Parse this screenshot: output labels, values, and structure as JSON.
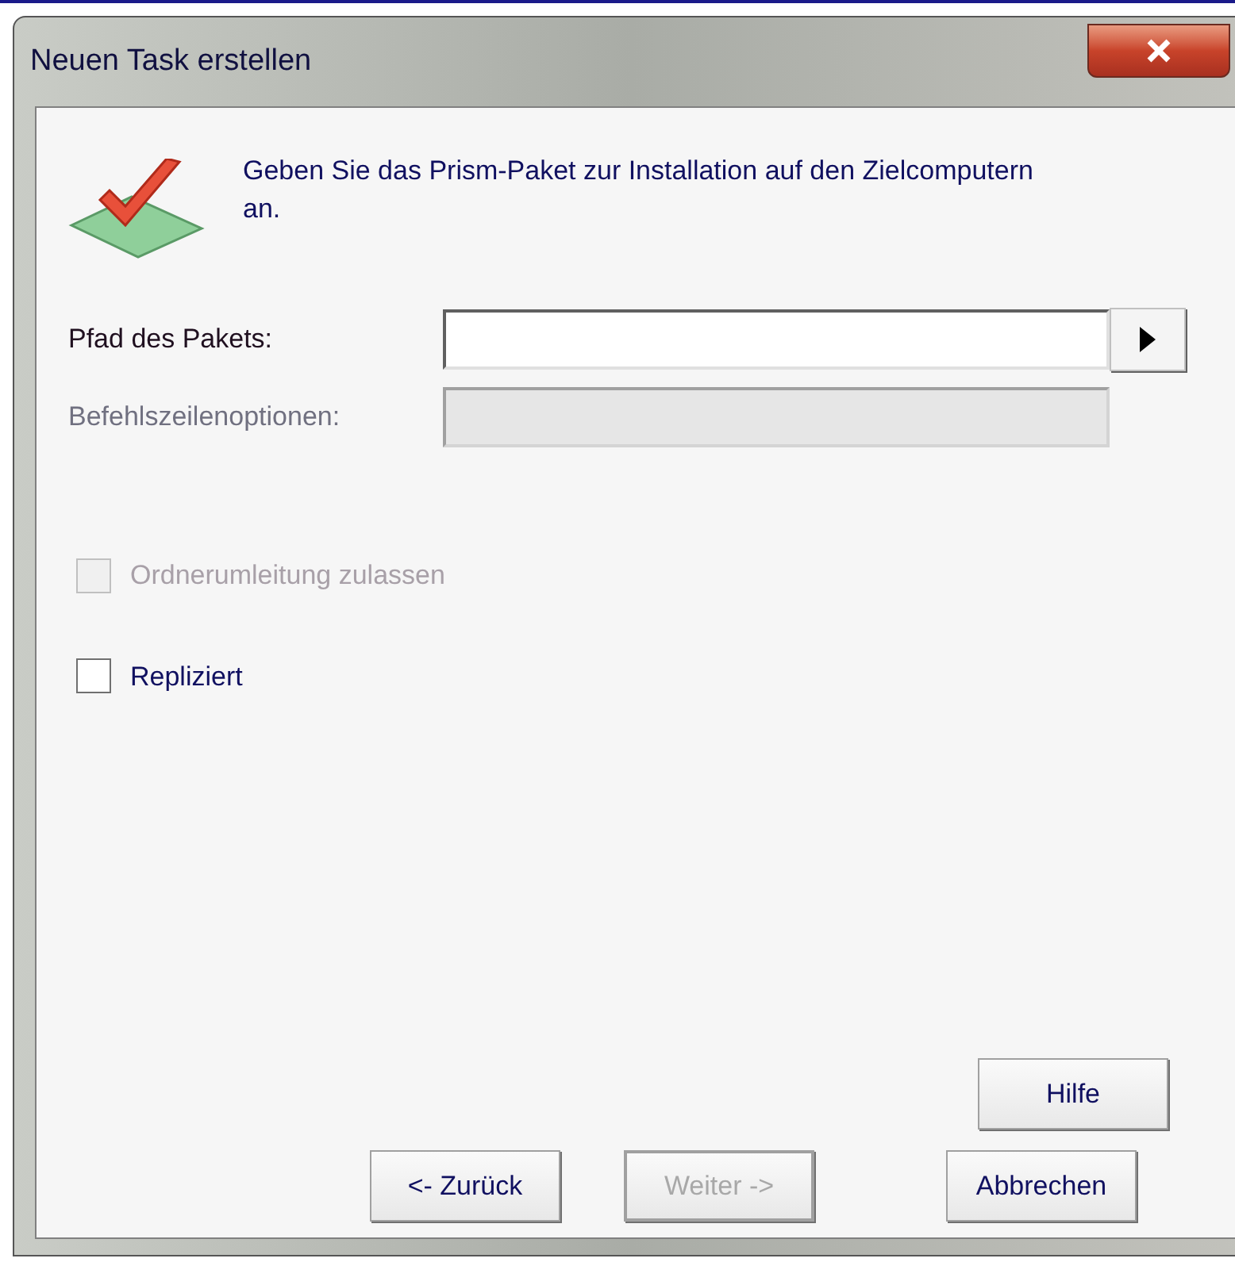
{
  "window": {
    "title": "Neuen Task erstellen"
  },
  "intro": "Geben Sie das Prism-Paket zur Installation auf den Zielcomputern an.",
  "fields": [
    {
      "label": "Pfad des Pakets:",
      "disabled": false,
      "browse": true
    },
    {
      "label": "Befehlszeilenoptionen:",
      "disabled": true,
      "browse": false
    }
  ],
  "checkboxes": [
    {
      "label": "Ordnerumleitung zulassen",
      "checked": false,
      "disabled": true
    },
    {
      "label": "Repliziert",
      "checked": false,
      "disabled": false
    }
  ],
  "help_button": {
    "label": "Hilfe"
  },
  "buttons": [
    {
      "label": "<- Zurück",
      "disabled": false,
      "default": false
    },
    {
      "label": "Weiter ->",
      "disabled": true,
      "default": true
    },
    {
      "label": "Abbrechen",
      "disabled": false,
      "default": false
    }
  ]
}
